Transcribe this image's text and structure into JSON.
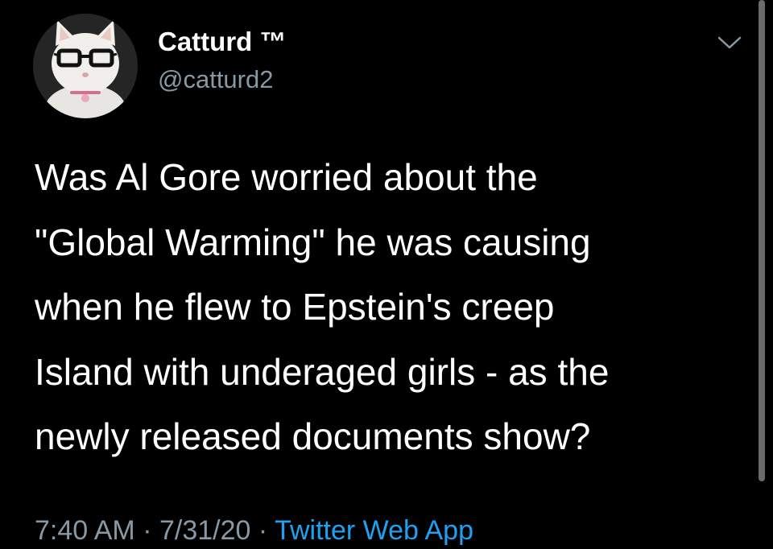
{
  "colors": {
    "background": "#000000",
    "text_primary": "#ffffff",
    "text_secondary": "#8899a6",
    "link": "#1da1f2"
  },
  "author": {
    "display_name": "Catturd ™",
    "handle": "@catturd2",
    "avatar_icon": "cat-with-glasses-avatar"
  },
  "tweet": {
    "lines": [
      "Was Al Gore worried about the",
      "\"Global Warming\" he was causing",
      "when he flew to Epstein's creep",
      "Island with underaged girls - as the",
      "newly released documents show?"
    ],
    "time": "7:40 AM",
    "date": "7/31/20",
    "separator": "·",
    "source": "Twitter Web App"
  },
  "controls": {
    "menu_icon": "chevron-down-icon"
  }
}
